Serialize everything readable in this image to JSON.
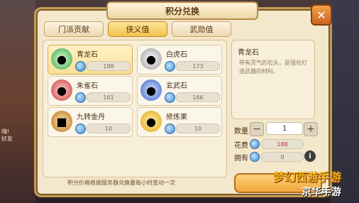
{
  "window": {
    "title": "积分兑换",
    "close_label": "✕"
  },
  "tabs": [
    {
      "label": "门派贡献",
      "active": false
    },
    {
      "label": "侠义值",
      "active": true
    },
    {
      "label": "武勋值",
      "active": false
    }
  ],
  "items": [
    {
      "name": "青龙石",
      "price": "188",
      "icon": "green-dragon-stone-icon"
    },
    {
      "name": "白虎石",
      "price": "173",
      "icon": "white-tiger-stone-icon"
    },
    {
      "name": "朱雀石",
      "price": "161",
      "icon": "vermilion-bird-stone-icon"
    },
    {
      "name": "玄武石",
      "price": "166",
      "icon": "black-tortoise-stone-icon"
    },
    {
      "name": "九转金丹",
      "price": "10",
      "icon": "golden-elixir-icon"
    },
    {
      "name": "修炼果",
      "price": "10",
      "icon": "cultivation-fruit-icon"
    }
  ],
  "detail": {
    "title": "青龙石",
    "desc": "带有灵气的石头，是强化打造武器的材料。"
  },
  "purchase": {
    "qty_label": "数量",
    "qty_value": "1",
    "minus": "−",
    "plus": "+",
    "cost_label": "花费",
    "cost_value": "188",
    "own_label": "拥有",
    "own_value": "0",
    "info": "i"
  },
  "footer": {
    "text": "积分价格根据服务器兑换量每小时变动一次"
  },
  "watermark": {
    "line1": "梦幻西游手游",
    "line2": "京华手游"
  },
  "side": {
    "tag1": "嗨!",
    "tag2": "好友"
  },
  "colors": {
    "accent": "#f1c24d",
    "panel": "#f3e7cc",
    "cost": "#d12a2a"
  }
}
